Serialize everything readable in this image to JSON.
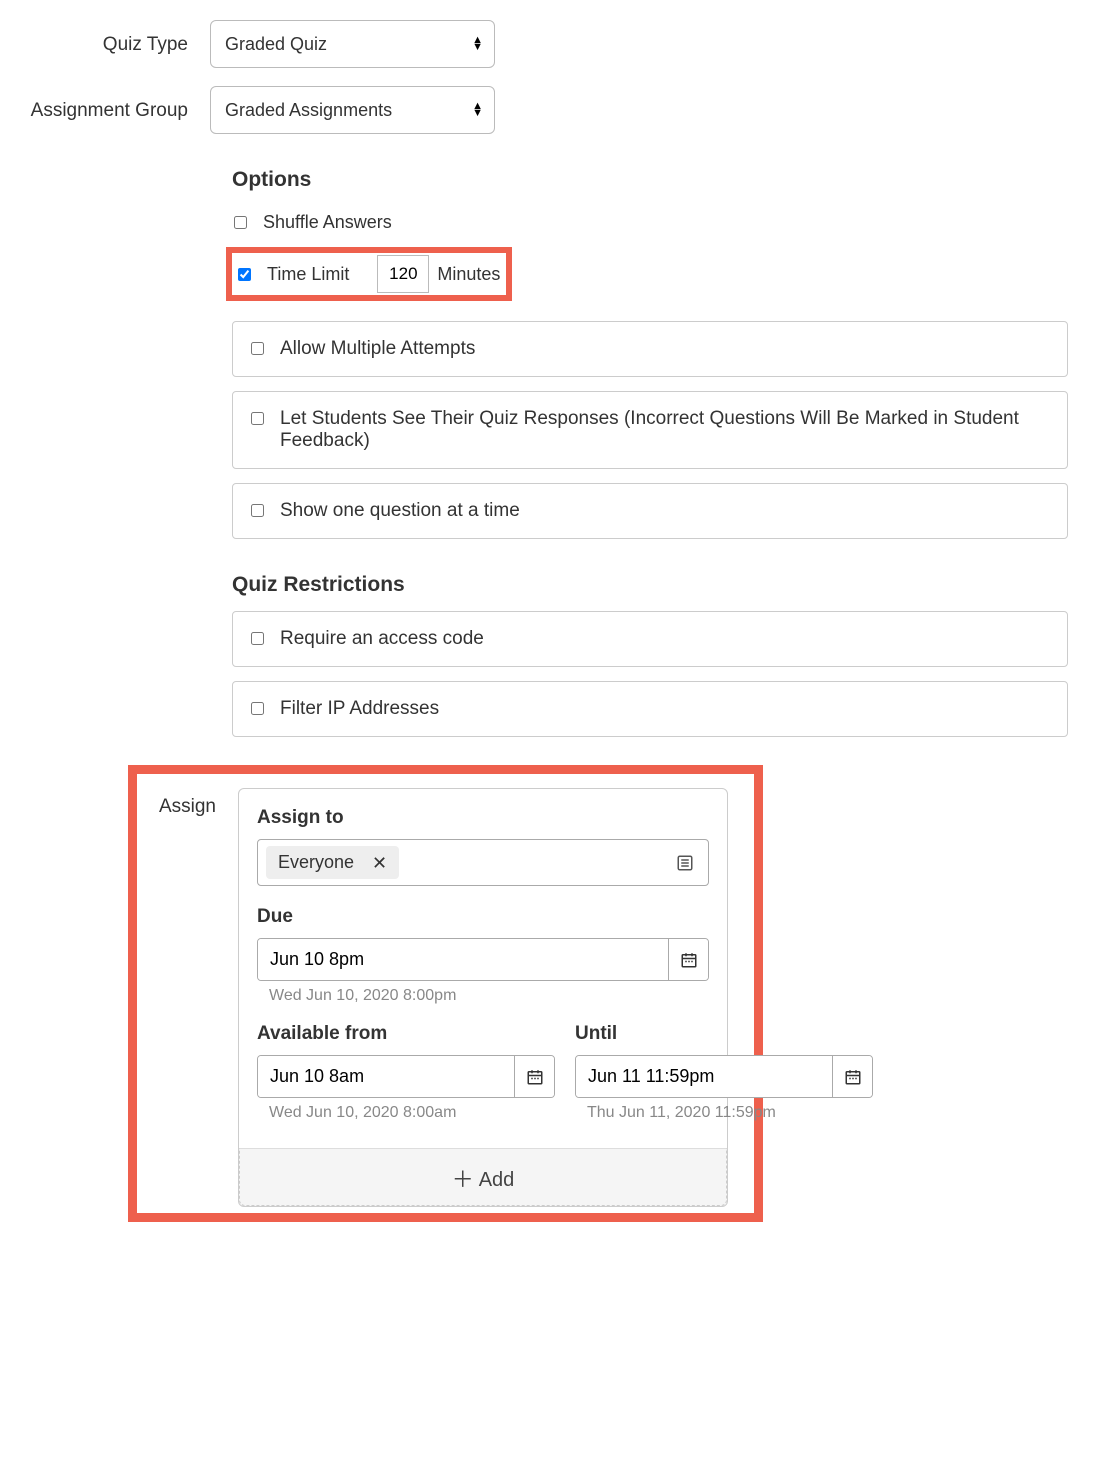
{
  "labels": {
    "quiz_type": "Quiz Type",
    "assignment_group": "Assignment Group",
    "assign": "Assign"
  },
  "selects": {
    "quiz_type": "Graded Quiz",
    "assignment_group": "Graded Assignments"
  },
  "sections": {
    "options_title": "Options",
    "restrictions_title": "Quiz Restrictions"
  },
  "options": {
    "shuffle_answers": {
      "label": "Shuffle Answers",
      "checked": false
    },
    "time_limit": {
      "label": "Time Limit",
      "checked": true,
      "value": "120",
      "unit": "Minutes"
    },
    "allow_multiple": {
      "label": "Allow Multiple Attempts",
      "checked": false
    },
    "let_students_see": {
      "label": "Let Students See Their Quiz Responses (Incorrect Questions Will Be Marked in Student Feedback)",
      "checked": false
    },
    "one_question": {
      "label": "Show one question at a time",
      "checked": false
    }
  },
  "restrictions": {
    "access_code": {
      "label": "Require an access code",
      "checked": false
    },
    "filter_ip": {
      "label": "Filter IP Addresses",
      "checked": false
    }
  },
  "assign": {
    "assign_to_label": "Assign to",
    "chip": "Everyone",
    "due_label": "Due",
    "due_value": "Jun 10 8pm",
    "due_hint": "Wed Jun 10, 2020 8:00pm",
    "available_from_label": "Available from",
    "until_label": "Until",
    "from_value": "Jun 10 8am",
    "from_hint": "Wed Jun 10, 2020 8:00am",
    "until_value": "Jun 11 11:59pm",
    "until_hint": "Thu Jun 11, 2020 11:59pm",
    "add_label": "Add"
  }
}
